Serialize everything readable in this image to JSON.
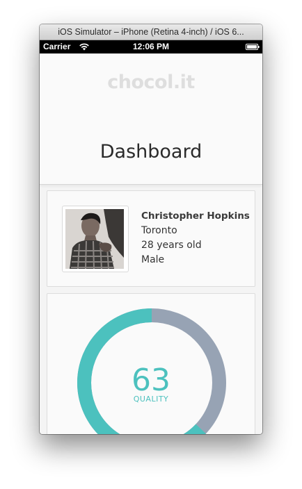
{
  "window": {
    "title": "iOS Simulator – iPhone (Retina 4-inch) / iOS 6..."
  },
  "statusbar": {
    "carrier": "Carrier",
    "time": "12:06 PM",
    "wifi_icon": "wifi-icon",
    "battery_icon": "battery-icon"
  },
  "header": {
    "logo": "chocol.it",
    "title": "Dashboard"
  },
  "profile": {
    "avatar_icon": "profile-photo",
    "name": "Christopher Hopkins",
    "city": "Toronto",
    "age": "28 years old",
    "gender": "Male"
  },
  "quality": {
    "value": "63",
    "label": "QUALITY",
    "percent": 63,
    "colors": {
      "filled": "#4cc1be",
      "remaining": "#97a3b4"
    }
  }
}
